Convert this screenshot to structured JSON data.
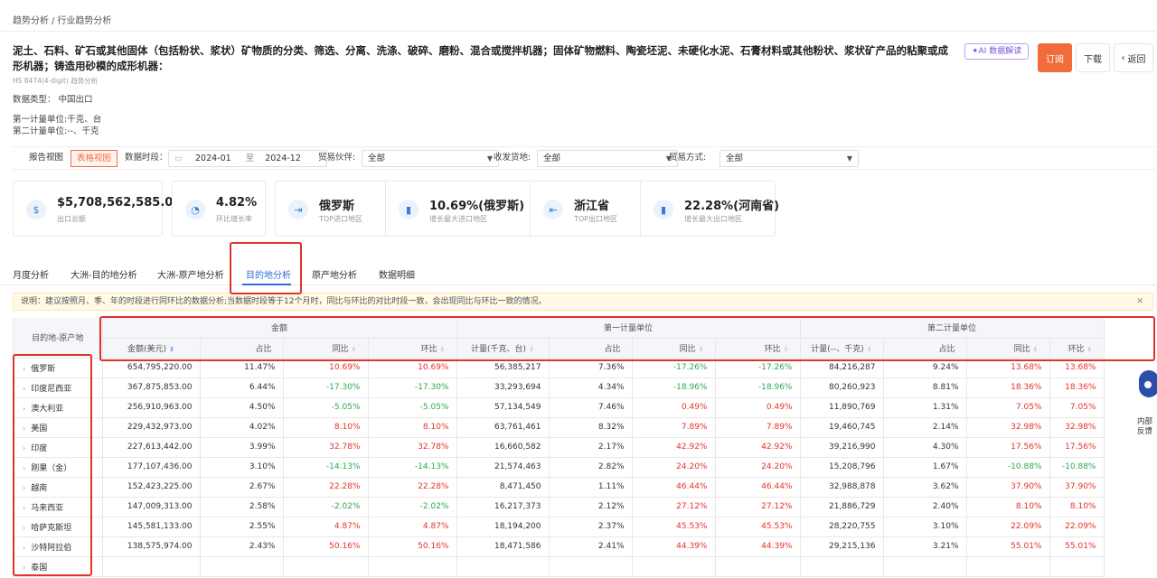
{
  "breadcrumb": {
    "first": "趋势分析",
    "sep": "/",
    "second": "行业趋势分析"
  },
  "title": "泥土、石料、矿石或其他固体（包括粉状、浆状）矿物质的分类、筛选、分离、洗涤、破碎、磨粉、混合或搅拌机器；固体矿物燃料、陶瓷坯泥、未硬化水泥、石膏材料或其他粉状、浆状矿产品的粘聚或成形机器；铸造用砂模的成形机器：",
  "subtitle": "HS 8474(4-digit) 趋势分析",
  "meta": {
    "data_type": "数据类型：  中国出口",
    "unit1": "第一计量单位:千克、台",
    "unit2": "第二计量单位:--、千克"
  },
  "buttons": {
    "ai": "AI 数据解读",
    "subscribe": "订阅",
    "download": "下载",
    "back": "返回"
  },
  "filters": {
    "report_view": "报告视图",
    "table_view": "表格视图",
    "period_label": "数据时段：",
    "date_from": "2024-01",
    "date_to_sep": "至",
    "date_to": "2024-12",
    "partner_label": "贸易伙伴:",
    "partner_value": "全部",
    "origin_label": "收发货地:",
    "origin_value": "全部",
    "mode_label": "贸易方式:",
    "mode_value": "全部"
  },
  "cards": [
    {
      "value": "$5,708,562,585.00",
      "label": "出口总额",
      "icon": "dollar-icon"
    },
    {
      "value": "4.82%",
      "label": "环比增长率",
      "icon": "pie-icon"
    },
    {
      "value": "俄罗斯",
      "label": "TOP进口地区",
      "icon": "import-icon"
    },
    {
      "value": "10.69%(俄罗斯)",
      "label": "增长最大进口地区",
      "icon": "chart-icon"
    },
    {
      "value": "浙江省",
      "label": "TOP出口地区",
      "icon": "export-icon"
    },
    {
      "value": "22.28%(河南省)",
      "label": "增长最大出口地区",
      "icon": "chart-icon"
    }
  ],
  "tabs": [
    "月度分析",
    "大洲-目的地分析",
    "大洲-原产地分析",
    "目的地分析",
    "原产地分析",
    "数据明细"
  ],
  "active_tab": "目的地分析",
  "notice": "说明：建议按照月、季、年的时段进行同环比的数据分析;当数据时段等于12个月时，同比与环比的对比时段一致，会出现同比与环比一致的情况。",
  "table": {
    "corner": "目的地-原产地",
    "groups": [
      "金额",
      "第一计量单位",
      "第二计量单位"
    ],
    "headers": [
      "金额(美元)",
      "占比",
      "同比",
      "环比",
      "计量(千克、台)",
      "占比",
      "同比",
      "环比",
      "计量(--、千克)",
      "占比",
      "同比",
      "环比"
    ],
    "rows": [
      {
        "name": "俄罗斯",
        "c": [
          "654,795,220.00",
          "11.47%",
          "10.69%",
          "10.69%",
          "56,385,217",
          "7.36%",
          "-17.26%",
          "-17.26%",
          "84,216,287",
          "9.24%",
          "13.68%",
          "13.68%"
        ]
      },
      {
        "name": "印度尼西亚",
        "c": [
          "367,875,853.00",
          "6.44%",
          "-17.30%",
          "-17.30%",
          "33,293,694",
          "4.34%",
          "-18.96%",
          "-18.96%",
          "80,260,923",
          "8.81%",
          "18.36%",
          "18.36%"
        ]
      },
      {
        "name": "澳大利亚",
        "c": [
          "256,910,963.00",
          "4.50%",
          "-5.05%",
          "-5.05%",
          "57,134,549",
          "7.46%",
          "0.49%",
          "0.49%",
          "11,890,769",
          "1.31%",
          "7.05%",
          "7.05%"
        ]
      },
      {
        "name": "美国",
        "c": [
          "229,432,973.00",
          "4.02%",
          "8.10%",
          "8.10%",
          "63,761,461",
          "8.32%",
          "7.89%",
          "7.89%",
          "19,460,745",
          "2.14%",
          "32.98%",
          "32.98%"
        ]
      },
      {
        "name": "印度",
        "c": [
          "227,613,442.00",
          "3.99%",
          "32.78%",
          "32.78%",
          "16,660,582",
          "2.17%",
          "42.92%",
          "42.92%",
          "39,216,990",
          "4.30%",
          "17.56%",
          "17.56%"
        ]
      },
      {
        "name": "刚果（金）",
        "c": [
          "177,107,436.00",
          "3.10%",
          "-14.13%",
          "-14.13%",
          "21,574,463",
          "2.82%",
          "24.20%",
          "24.20%",
          "15,208,796",
          "1.67%",
          "-10.88%",
          "-10.88%"
        ]
      },
      {
        "name": "越南",
        "c": [
          "152,423,225.00",
          "2.67%",
          "22.28%",
          "22.28%",
          "8,471,450",
          "1.11%",
          "46.44%",
          "46.44%",
          "32,988,878",
          "3.62%",
          "37.90%",
          "37.90%"
        ]
      },
      {
        "name": "马来西亚",
        "c": [
          "147,009,313.00",
          "2.58%",
          "-2.02%",
          "-2.02%",
          "16,217,373",
          "2.12%",
          "27.12%",
          "27.12%",
          "21,886,729",
          "2.40%",
          "8.10%",
          "8.10%"
        ]
      },
      {
        "name": "哈萨克斯坦",
        "c": [
          "145,581,133.00",
          "2.55%",
          "4.87%",
          "4.87%",
          "18,194,200",
          "2.37%",
          "45.53%",
          "45.53%",
          "28,220,755",
          "3.10%",
          "22.09%",
          "22.09%"
        ]
      },
      {
        "name": "沙特阿拉伯",
        "c": [
          "138,575,974.00",
          "2.43%",
          "50.16%",
          "50.16%",
          "18,471,586",
          "2.41%",
          "44.39%",
          "44.39%",
          "29,215,136",
          "3.21%",
          "55.01%",
          "55.01%"
        ]
      },
      {
        "name": "泰国",
        "c": [
          "",
          "",
          "",
          "",
          "",
          "",
          "",
          "",
          "",
          "",
          "",
          ""
        ]
      }
    ]
  },
  "side_widget": {
    "label": "内部反馈"
  },
  "colors": {
    "accent": "#f26b3a",
    "primary": "#2f6fd6",
    "up": "#e5322d",
    "down": "#2fa84f",
    "annotation": "#e0312b"
  }
}
